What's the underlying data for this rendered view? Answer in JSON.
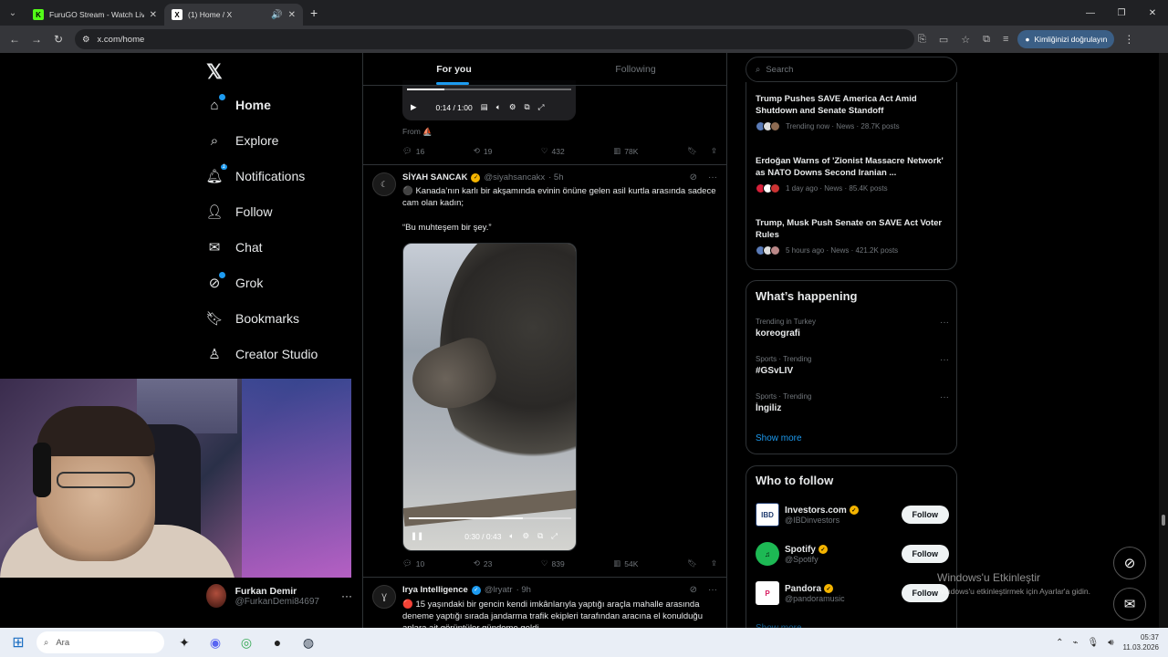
{
  "browser": {
    "tabs": [
      {
        "title": "FuruGO Stream - Watch Live on",
        "active": false,
        "favicon": "K",
        "favicon_color": "#53fc18"
      },
      {
        "title": "(1) Home / X",
        "active": true,
        "favicon": "X",
        "favicon_color": "#000000"
      }
    ],
    "url": "x.com/home",
    "profile_label": "Kimliğinizi doğrulayın"
  },
  "nav": {
    "items": [
      {
        "label": "Home",
        "icon": "home-icon"
      },
      {
        "label": "Explore",
        "icon": "search-icon"
      },
      {
        "label": "Notifications",
        "icon": "bell-icon",
        "badge": "1"
      },
      {
        "label": "Follow",
        "icon": "person-add-icon"
      },
      {
        "label": "Chat",
        "icon": "mail-icon"
      },
      {
        "label": "Grok",
        "icon": "grok-icon"
      },
      {
        "label": "Bookmarks",
        "icon": "bookmark-icon"
      },
      {
        "label": "Creator Studio",
        "icon": "creator-icon"
      }
    ],
    "account": {
      "name": "Furkan Demir",
      "handle": "@FurkanDemi84697"
    }
  },
  "timeline": {
    "tabs": [
      "For you",
      "Following"
    ],
    "post1": {
      "video_time": "0:14 / 1:00",
      "video_progress": 0.23,
      "from": "From",
      "replies": "16",
      "reposts": "19",
      "likes": "432",
      "views": "78K"
    },
    "post2": {
      "name": "SİYAH SANCAK",
      "handle": "@siyahsancakx",
      "time": "· 5h",
      "text1": "⚫ Kanada’nın karlı bir akşamında evinin önüne gelen asil kurtla arasında sadece cam olan kadın;",
      "text2": "“Bu muhteşem bir şey.”",
      "video_time": "0:30 / 0:43",
      "video_progress": 0.7,
      "replies": "10",
      "reposts": "23",
      "likes": "839",
      "views": "54K"
    },
    "post3": {
      "name": "Irya Intelligence",
      "handle": "@lryatr",
      "time": "· 9h",
      "text": "🔴 15 yaşındaki bir gencin kendi imkânlarıyla yaptığı araçla mahalle arasında deneme yaptığı sırada jandarma trafik ekipleri tarafından aracına el konulduğu anlara ait görüntüler gündeme geldi."
    }
  },
  "right": {
    "search_placeholder": "Search",
    "news": [
      {
        "headline": "Trump Pushes SAVE America Act Amid Shutdown and Senate Standoff",
        "meta": "Trending now · News · 28.7K posts"
      },
      {
        "headline": "Erdoğan Warns of 'Zionist Massacre Network' as NATO Downs Second Iranian ...",
        "meta": "1 day ago · News · 85.4K posts"
      },
      {
        "headline": "Trump, Musk Push Senate on SAVE Act Voter Rules",
        "meta": "5 hours ago · News · 421.2K posts"
      }
    ],
    "happening": {
      "title": "What’s happening",
      "trends": [
        {
          "context": "Trending in Turkey",
          "name": "koreografi"
        },
        {
          "context": "Sports · Trending",
          "name": "#GSvLIV"
        },
        {
          "context": "Sports · Trending",
          "name": "İngiliz"
        }
      ],
      "show_more": "Show more"
    },
    "who_to_follow": {
      "title": "Who to follow",
      "accounts": [
        {
          "name": "Investors.com",
          "handle": "@IBDinvestors",
          "pic": "IBD",
          "pic_color": "#1f3b6e"
        },
        {
          "name": "Spotify",
          "handle": "@Spotify",
          "pic": "♫",
          "pic_color": "#1db954"
        },
        {
          "name": "Pandora",
          "handle": "@pandoramusic",
          "pic": "P",
          "pic_color": "#ffffff"
        }
      ],
      "follow_label": "Follow",
      "show_more": "Show more"
    }
  },
  "windows": {
    "activate_title": "Windows'u Etkinleştir",
    "activate_sub": "Windows'u etkinleştirmek için Ayarlar'a gidin.",
    "search_placeholder": "Ara",
    "time": "05:37",
    "date": "11.03.2026"
  }
}
